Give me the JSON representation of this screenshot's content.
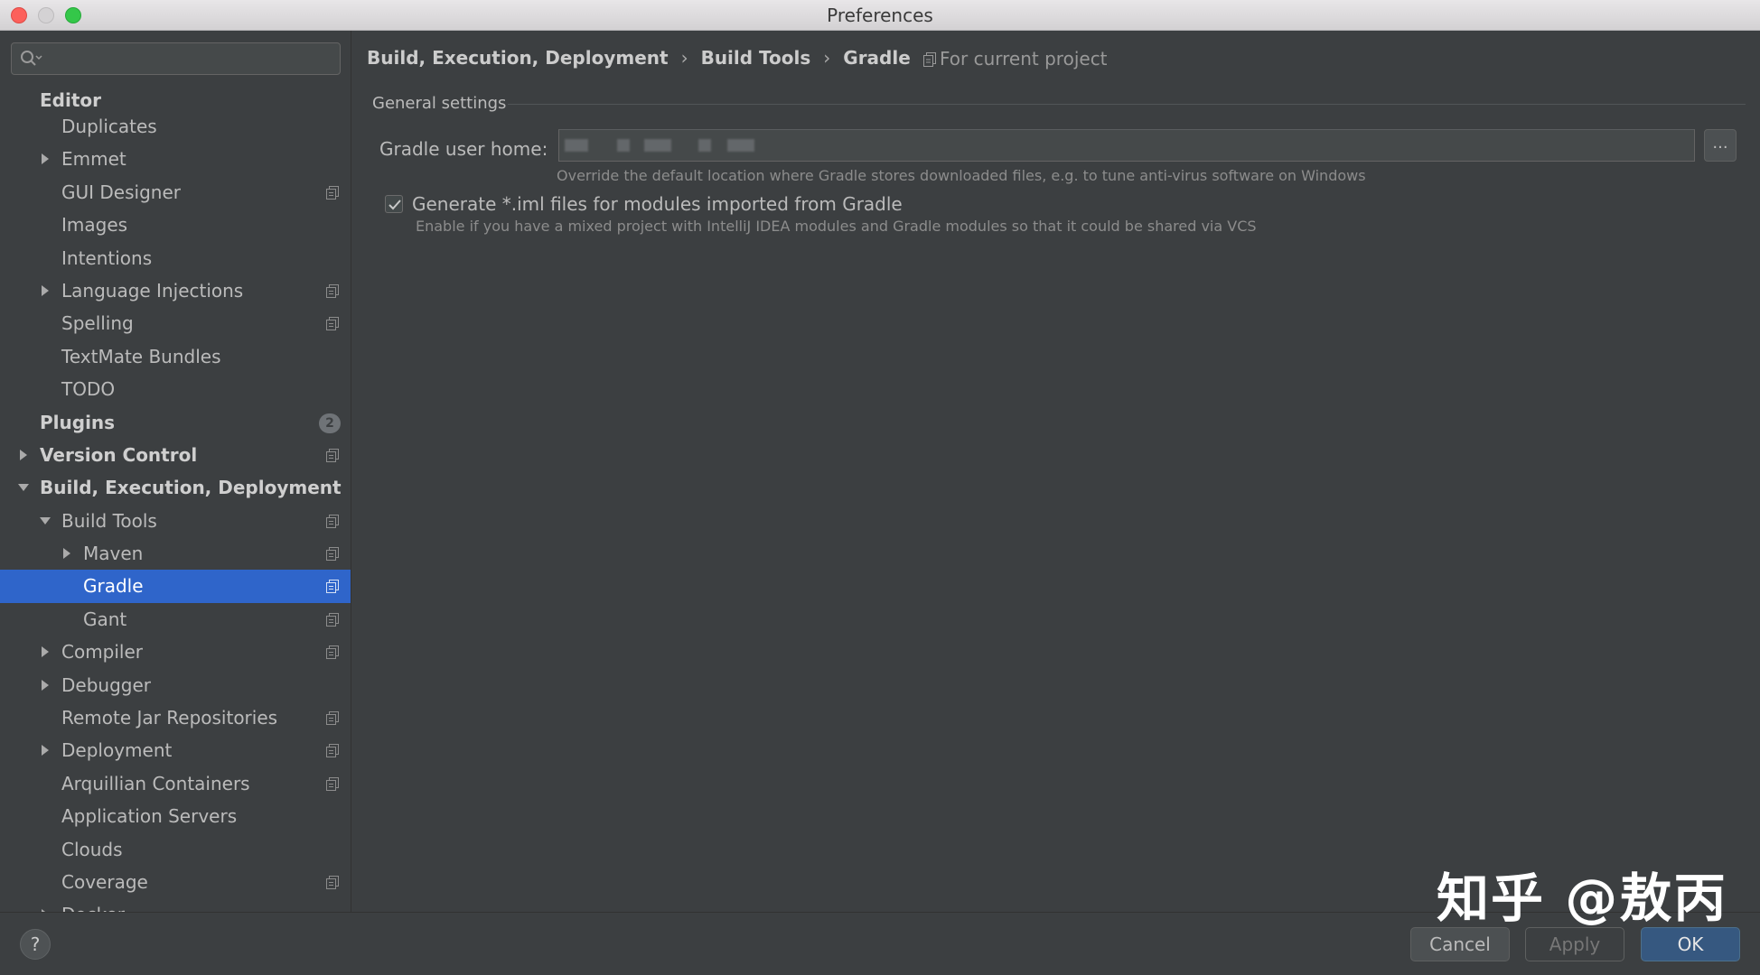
{
  "window": {
    "title": "Preferences"
  },
  "sidebar": {
    "search_placeholder": "",
    "items": [
      {
        "label": "Editor",
        "level": 0,
        "section": true,
        "arrow": "",
        "proj": false
      },
      {
        "label": "Duplicates",
        "level": 1,
        "arrow": "",
        "proj": false
      },
      {
        "label": "Emmet",
        "level": 1,
        "arrow": "right",
        "proj": false
      },
      {
        "label": "GUI Designer",
        "level": 1,
        "arrow": "",
        "proj": true
      },
      {
        "label": "Images",
        "level": 1,
        "arrow": "",
        "proj": false
      },
      {
        "label": "Intentions",
        "level": 1,
        "arrow": "",
        "proj": false
      },
      {
        "label": "Language Injections",
        "level": 1,
        "arrow": "right",
        "proj": true
      },
      {
        "label": "Spelling",
        "level": 1,
        "arrow": "",
        "proj": true
      },
      {
        "label": "TextMate Bundles",
        "level": 1,
        "arrow": "",
        "proj": false
      },
      {
        "label": "TODO",
        "level": 1,
        "arrow": "",
        "proj": false
      },
      {
        "label": "Plugins",
        "level": 0,
        "section": true,
        "arrow": "",
        "proj": false,
        "badge": "2"
      },
      {
        "label": "Version Control",
        "level": 0,
        "section": true,
        "arrow": "right",
        "proj": true
      },
      {
        "label": "Build, Execution, Deployment",
        "level": 0,
        "section": true,
        "arrow": "down",
        "proj": false
      },
      {
        "label": "Build Tools",
        "level": 1,
        "arrow": "down",
        "proj": true
      },
      {
        "label": "Maven",
        "level": 2,
        "arrow": "right",
        "proj": true
      },
      {
        "label": "Gradle",
        "level": 2,
        "arrow": "",
        "proj": true,
        "selected": true
      },
      {
        "label": "Gant",
        "level": 2,
        "arrow": "",
        "proj": true
      },
      {
        "label": "Compiler",
        "level": 1,
        "arrow": "right",
        "proj": true
      },
      {
        "label": "Debugger",
        "level": 1,
        "arrow": "right",
        "proj": false
      },
      {
        "label": "Remote Jar Repositories",
        "level": 1,
        "arrow": "",
        "proj": true
      },
      {
        "label": "Deployment",
        "level": 1,
        "arrow": "right",
        "proj": true
      },
      {
        "label": "Arquillian Containers",
        "level": 1,
        "arrow": "",
        "proj": true
      },
      {
        "label": "Application Servers",
        "level": 1,
        "arrow": "",
        "proj": false
      },
      {
        "label": "Clouds",
        "level": 1,
        "arrow": "",
        "proj": false
      },
      {
        "label": "Coverage",
        "level": 1,
        "arrow": "",
        "proj": true
      },
      {
        "label": "Docker",
        "level": 1,
        "arrow": "right",
        "proj": false
      }
    ]
  },
  "breadcrumb": {
    "items": [
      "Build, Execution, Deployment",
      "Build Tools",
      "Gradle"
    ],
    "separator": "›",
    "scope": "For current project"
  },
  "general": {
    "group_title": "General settings",
    "gradle_home_label": "Gradle user home:",
    "gradle_home_value": "",
    "browse_label": "...",
    "gradle_home_hint": "Override the default location where Gradle stores downloaded files, e.g. to tune anti-virus software on Windows",
    "iml_checked": true,
    "iml_label": "Generate *.iml files for modules imported from Gradle",
    "iml_hint": "Enable if you have a mixed project with IntelliJ IDEA modules and Gradle modules so that it could be shared via VCS"
  },
  "footer": {
    "help_label": "?",
    "cancel_label": "Cancel",
    "apply_label": "Apply",
    "ok_label": "OK"
  },
  "watermark": "知乎 @敖丙",
  "colors": {
    "background": "#3c3f41",
    "selection": "#2f65ca",
    "ok_button": "#365880",
    "text": "#bbbbbb"
  }
}
